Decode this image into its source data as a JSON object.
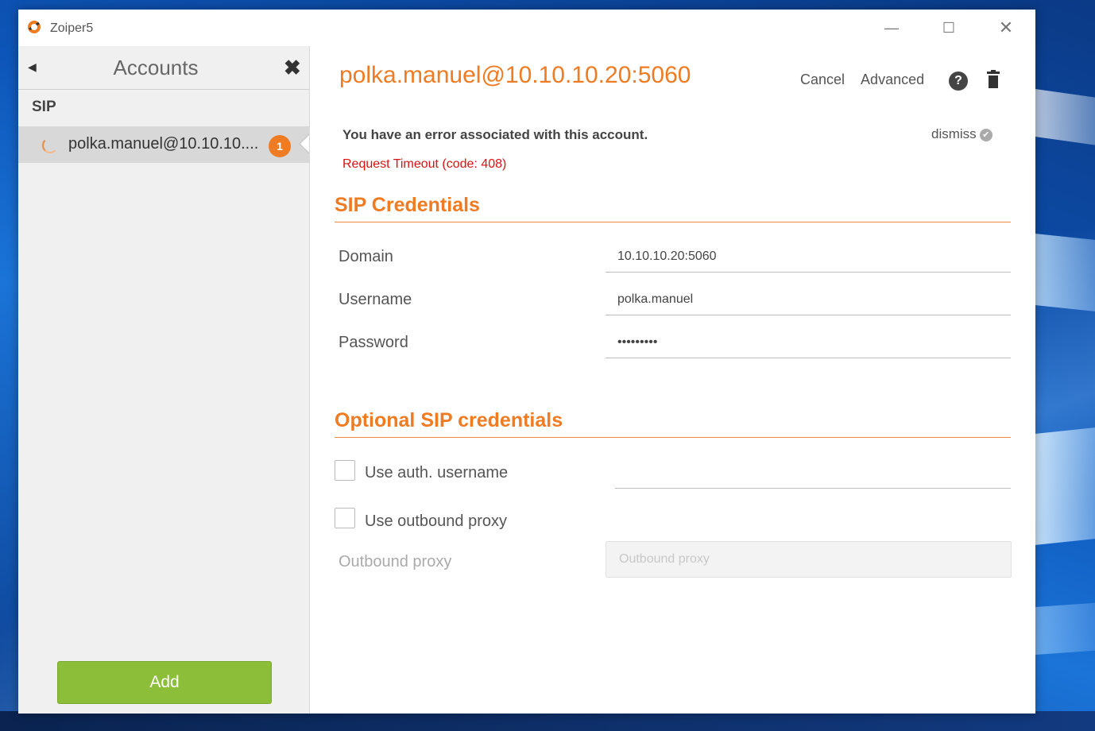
{
  "window": {
    "title": "Zoiper5",
    "minimize_glyph": "—",
    "maximize_glyph": "☐",
    "close_glyph": "✕"
  },
  "sidebar": {
    "back_glyph": "◀",
    "title": "Accounts",
    "close_glyph": "✖",
    "section": "SIP",
    "items": [
      {
        "label": "polka.manuel@10.10.10....",
        "badge": "1",
        "status": "connecting"
      }
    ],
    "add_label": "Add"
  },
  "account": {
    "title": "polka.manuel@10.10.10.20:5060",
    "actions": {
      "cancel": "Cancel",
      "advanced": "Advanced"
    },
    "help_glyph": "?",
    "error": {
      "title": "You have an error associated with this account.",
      "message": "Request Timeout (code: 408)",
      "dismiss": "dismiss",
      "dismiss_glyph": "✔"
    }
  },
  "sip_credentials": {
    "heading": "SIP Credentials",
    "domain_label": "Domain",
    "domain_value": "10.10.10.20:5060",
    "username_label": "Username",
    "username_value": "polka.manuel",
    "password_label": "Password",
    "password_value": "•••••••••"
  },
  "optional": {
    "heading": "Optional SIP credentials",
    "use_auth_label": "Use auth. username",
    "use_auth_checked": false,
    "use_proxy_label": "Use outbound proxy",
    "use_proxy_checked": false,
    "proxy_label": "Outbound proxy",
    "proxy_placeholder": "Outbound proxy"
  },
  "colors": {
    "accent": "#ef7b22",
    "error": "#dd1111",
    "add_button": "#8dbe3a"
  }
}
